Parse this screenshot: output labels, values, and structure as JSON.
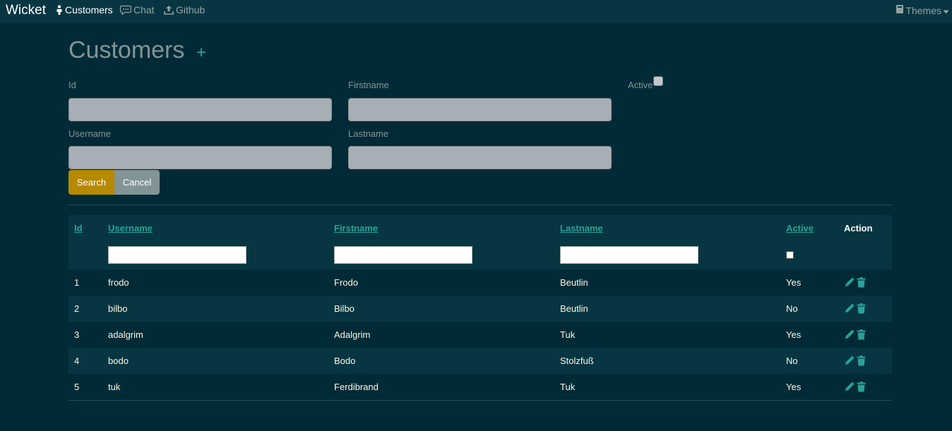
{
  "navbar": {
    "brand": "Wicket",
    "items": [
      {
        "label": "Customers",
        "icon": "person-icon",
        "active": true
      },
      {
        "label": "Chat",
        "icon": "chat-bubble-icon",
        "active": false
      },
      {
        "label": "Github",
        "icon": "upload-icon",
        "active": false
      }
    ],
    "themes_label": "Themes"
  },
  "page": {
    "title": "Customers",
    "add_symbol": "+"
  },
  "search_form": {
    "id_label": "Id",
    "firstname_label": "Firstname",
    "active_label": "Active",
    "username_label": "Username",
    "lastname_label": "Lastname",
    "id_value": "",
    "firstname_value": "",
    "username_value": "",
    "lastname_value": "",
    "active_checked": false,
    "search_button": "Search",
    "cancel_button": "Cancel"
  },
  "table": {
    "columns": [
      "Id",
      "Username",
      "Firstname",
      "Lastname",
      "Active",
      "Action"
    ],
    "rows": [
      {
        "id": "1",
        "username": "frodo",
        "firstname": "Frodo",
        "lastname": "Beutlin",
        "active": "Yes"
      },
      {
        "id": "2",
        "username": "bilbo",
        "firstname": "Bilbo",
        "lastname": "Beutlin",
        "active": "No"
      },
      {
        "id": "3",
        "username": "adalgrim",
        "firstname": "Adalgrim",
        "lastname": "Tuk",
        "active": "Yes"
      },
      {
        "id": "4",
        "username": "bodo",
        "firstname": "Bodo",
        "lastname": "Stolzfuß",
        "active": "No"
      },
      {
        "id": "5",
        "username": "tuk",
        "firstname": "Ferdibrand",
        "lastname": "Tuk",
        "active": "Yes"
      }
    ]
  },
  "colors": {
    "background": "#002b36",
    "panel": "#073642",
    "accent": "#2aa198",
    "search_button": "#b58900",
    "cancel_button": "#839496"
  }
}
